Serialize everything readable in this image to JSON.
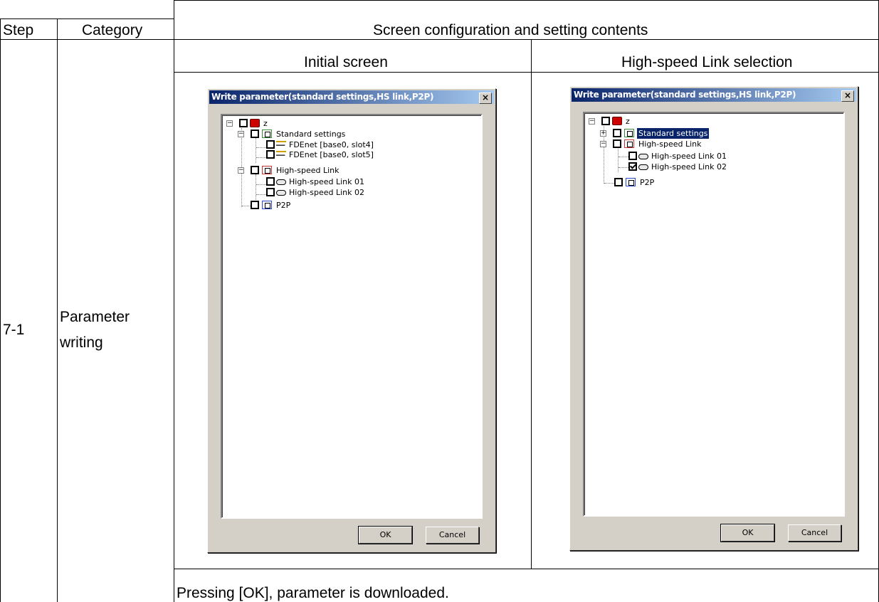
{
  "table": {
    "headers": {
      "step": "Step",
      "category": "Category",
      "content": "Screen configuration and setting contents"
    },
    "row": {
      "step": "7-1",
      "category_line1": "Parameter",
      "category_line2": "writing",
      "subheaders": {
        "left": "Initial screen",
        "right": "High-speed Link selection"
      },
      "footer_note": "Pressing [OK], parameter is downloaded."
    }
  },
  "dialog_left": {
    "title": "Write parameter(standard settings,HS link,P2P)",
    "close_glyph": "×",
    "tree": {
      "root": "z",
      "standard_settings": "Standard settings",
      "fdenet_1": "FDEnet [base0, slot4]",
      "fdenet_2": "FDEnet [base0, slot5]",
      "hs_link": "High-speed Link",
      "hs_link_01": "High-speed Link 01",
      "hs_link_02": "High-speed Link 02",
      "p2p": "P2P"
    },
    "ok": "OK",
    "cancel": "Cancel"
  },
  "dialog_right": {
    "title": "Write parameter(standard settings,HS link,P2P)",
    "close_glyph": "×",
    "tree": {
      "root": "z",
      "standard_settings": "Standard settings",
      "hs_link": "High-speed Link",
      "hs_link_01": "High-speed Link 01",
      "hs_link_02": "High-speed Link 02",
      "p2p": "P2P"
    },
    "checked_item": "High-speed Link 02",
    "ok": "OK",
    "cancel": "Cancel"
  },
  "icons": {
    "expanded": "−",
    "collapsed": "+"
  }
}
